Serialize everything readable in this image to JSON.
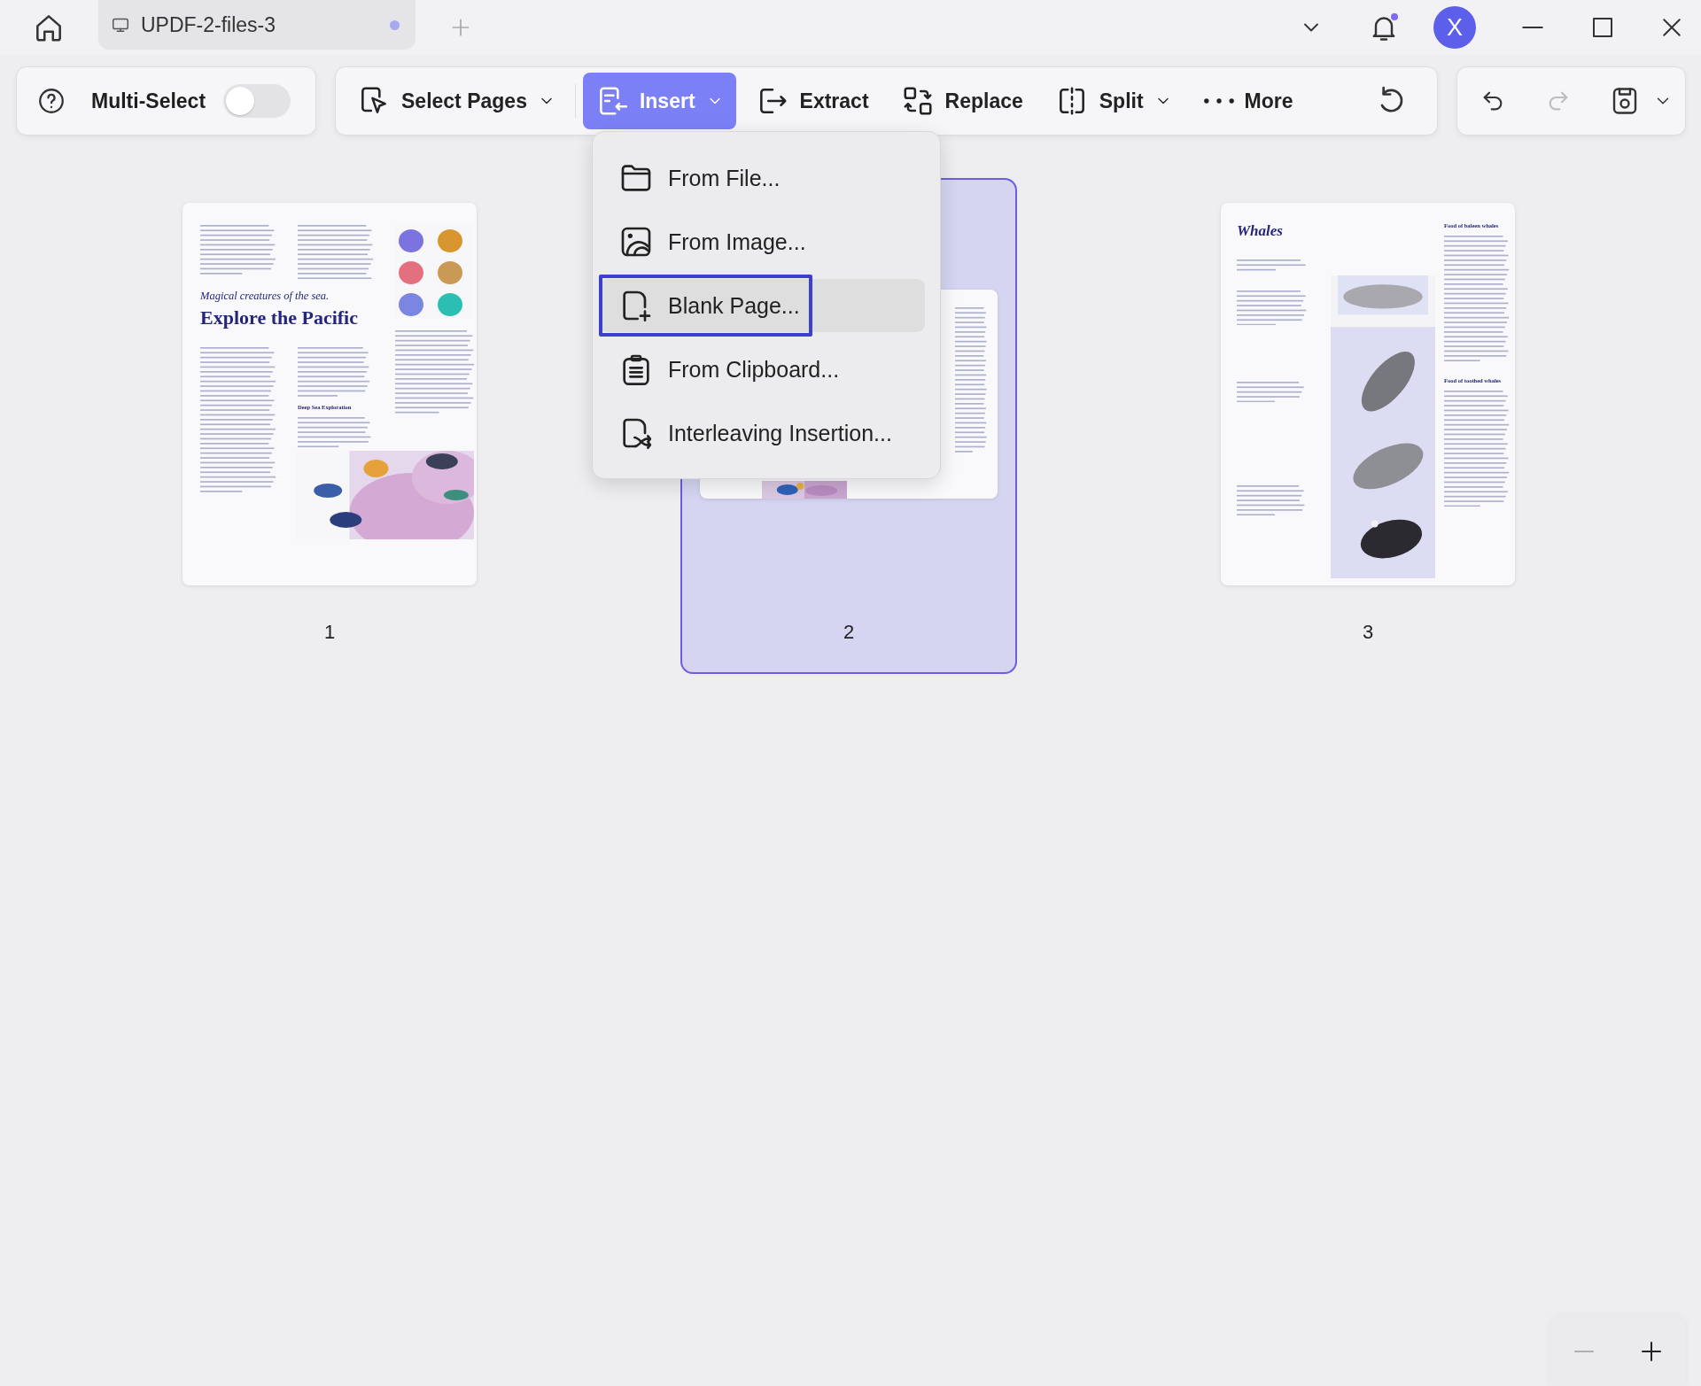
{
  "title_bar": {
    "tabs": [
      {
        "title": "UPDF-2-files-3",
        "selected": true,
        "unsaved": true
      }
    ],
    "notifications": {
      "unread": true
    },
    "account": {
      "initial": "X"
    }
  },
  "toolbar": {
    "multi_select": {
      "label": "Multi-Select",
      "on": false
    },
    "tools": [
      {
        "label": "Select Pages",
        "kind": "dropdown",
        "selected": false
      },
      {
        "label": "Insert",
        "kind": "dropdown",
        "selected": true
      },
      {
        "label": "Extract",
        "kind": "button",
        "selected": false
      },
      {
        "label": "Replace",
        "kind": "button",
        "selected": false
      },
      {
        "label": "Split",
        "kind": "dropdown",
        "selected": false
      },
      {
        "label": "More",
        "kind": "button",
        "selected": false
      }
    ],
    "redo_disabled": true
  },
  "insert_menu": [
    {
      "label": "From File...",
      "selected": false,
      "outlined": false
    },
    {
      "label": "From Image...",
      "selected": false,
      "outlined": false
    },
    {
      "label": "Blank Page...",
      "selected": true,
      "outlined": true
    },
    {
      "label": "From Clipboard...",
      "selected": false,
      "outlined": false
    },
    {
      "label": "Interleaving Insertion...",
      "selected": false,
      "outlined": false
    }
  ],
  "pages": [
    {
      "number": "1",
      "selected": false,
      "kind": "magazine",
      "subtitle": "Magical creatures of the sea.",
      "title": "Explore the Pacific",
      "section": "Deep Sea Exploration"
    },
    {
      "number": "2",
      "selected": true,
      "kind": "spread"
    },
    {
      "number": "3",
      "selected": false,
      "kind": "whales",
      "title": "Whales",
      "headings": [
        "Food of baleen whales",
        "Food of toothed whales"
      ]
    }
  ],
  "zoom": {
    "out_disabled": true
  }
}
